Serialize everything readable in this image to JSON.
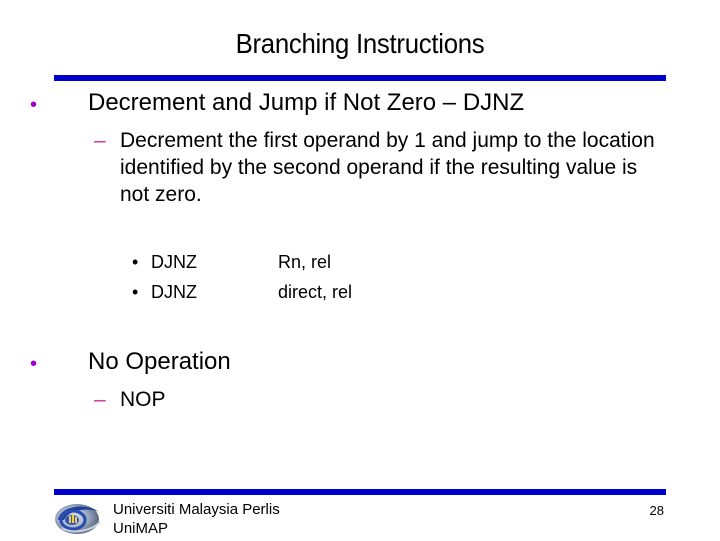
{
  "slide": {
    "title": "Branching Instructions",
    "colors": {
      "rule": "#0000CC",
      "level1_bullet": "#9900CC",
      "level2_dash": "#CC3399",
      "text": "#000000"
    },
    "bullets": [
      {
        "glyph": "•",
        "text": "Decrement and Jump if Not Zero – DJNZ",
        "sub": {
          "glyph": "–",
          "text": "Decrement the first operand by 1 and jump to the location identified by the second operand if the resulting value is not zero.",
          "syntax": [
            {
              "glyph": "•",
              "mnemonic": "DJNZ",
              "operands": "Rn, rel"
            },
            {
              "glyph": "•",
              "mnemonic": "DJNZ",
              "operands": "direct, rel"
            }
          ]
        }
      },
      {
        "glyph": "•",
        "text": "No Operation",
        "sub": {
          "glyph": "–",
          "text": "NOP"
        }
      }
    ]
  },
  "footer": {
    "logo_icon": "unimap-logo-icon",
    "org_line1": "Universiti Malaysia Perlis",
    "org_line2": "UniMAP",
    "page_number": "28"
  }
}
